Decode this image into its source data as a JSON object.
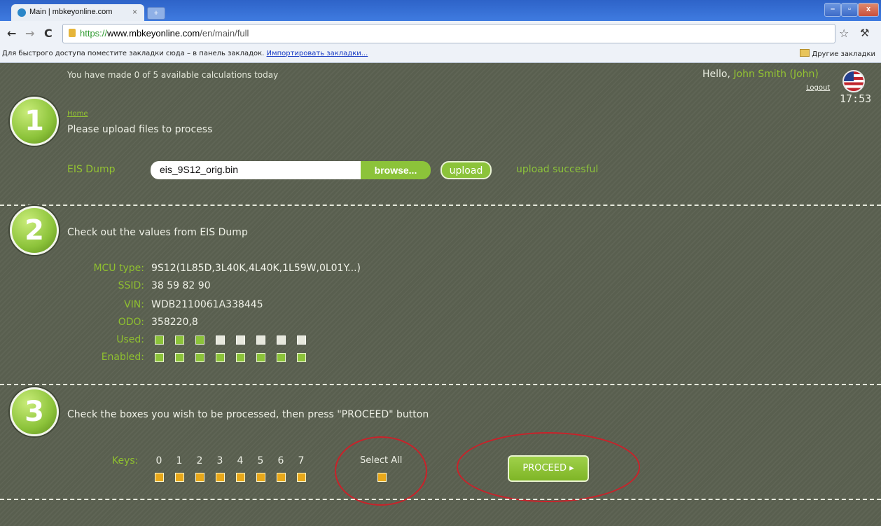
{
  "browser": {
    "tab_title": "Main | mbkeyonline.com",
    "tab_close": "×",
    "new_tab": "+",
    "window_buttons": [
      "–",
      "▫",
      "x"
    ],
    "nav": {
      "back": "←",
      "forward": "→",
      "reload": "C"
    },
    "url_scheme": "https://",
    "url_host": "www.mbkeyonline.com",
    "url_path": "/en/main/full",
    "star": "☆",
    "wrench": "🔧",
    "bookmarks_message": "Для быстрого доступа поместите закладки сюда – в панель закладок.",
    "bookmarks_import": "Импортировать закладки...",
    "other_bookmarks": "Другие закладки"
  },
  "header": {
    "calc_message": "You have made 0 of 5 available calculations today",
    "hello_prefix": "Hello, ",
    "user_name": "John Smith (John)",
    "logout": "Logout",
    "time": "17:53",
    "flag_icon": "us-flag-icon"
  },
  "step1": {
    "number": "1",
    "home_link": "Home",
    "title": "Please upload files to process",
    "field_label": "EIS Dump",
    "file_value": "eis_9S12_orig.bin",
    "browse_label": "browse...",
    "upload_label": "upload",
    "status": "upload succesful"
  },
  "step2": {
    "number": "2",
    "title": "Check out the values from EIS Dump",
    "mcu_label": "MCU type:",
    "mcu_value": "9S12(1L85D,3L40K,4L40K,1L59W,0L01Y...)",
    "ssid_label": "SSID:",
    "ssid_value": "38 59 82 90",
    "vin_label": "VIN:",
    "vin_value": "WDB2110061A338445",
    "odo_label": "ODO:",
    "odo_value": "358220,8",
    "used_label": "Used:",
    "used": [
      true,
      true,
      true,
      false,
      false,
      false,
      false,
      false
    ],
    "enabled_label": "Enabled:",
    "enabled": [
      true,
      true,
      true,
      true,
      true,
      true,
      true,
      true
    ]
  },
  "step3": {
    "number": "3",
    "title": "Check the boxes you wish to be processed, then press \"PROCEED\" button",
    "keys_label": "Keys:",
    "keys": [
      "0",
      "1",
      "2",
      "3",
      "4",
      "5",
      "6",
      "7"
    ],
    "select_all_label": "Select All",
    "proceed_label": "PROCEED ▸"
  },
  "colors": {
    "accent": "#8cc33a",
    "background": "#595f4f",
    "annotation": "#c9222a",
    "checkbox": "#e8a81a"
  }
}
